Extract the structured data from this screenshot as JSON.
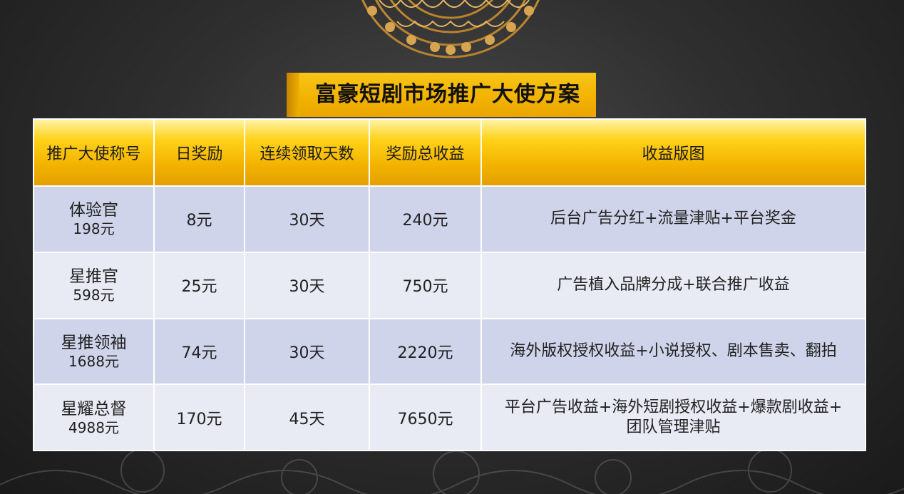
{
  "title": "富豪短剧市场推广大使方案",
  "table": {
    "headers": [
      "推广大使称号",
      "日奖励",
      "连续领取天数",
      "奖励总收益",
      "收益版图"
    ],
    "rows": [
      {
        "title": "体验官",
        "price": "198元",
        "daily": "8元",
        "days": "30天",
        "total": "240元",
        "benefits": "后台广告分红+流量津贴+平台奖金",
        "benefits2": ""
      },
      {
        "title": "星推官",
        "price": "598元",
        "daily": "25元",
        "days": "30天",
        "total": "750元",
        "benefits": "广告植入品牌分成+联合推广收益",
        "benefits2": ""
      },
      {
        "title": "星推领袖",
        "price": "1688元",
        "daily": "74元",
        "days": "30天",
        "total": "2220元",
        "benefits": "海外版权授权收益+小说授权、剧本售卖、翻拍",
        "benefits2": ""
      },
      {
        "title": "星耀总督",
        "price": "4988元",
        "daily": "170元",
        "days": "45天",
        "total": "7650元",
        "benefits": "平台广告收益+海外短剧授权收益+爆款剧收益+",
        "benefits2": "团队管理津贴"
      }
    ]
  },
  "colors": {
    "gold": "#f3b300",
    "row_blue": "#cfd4ea",
    "row_light": "#e8eaf4",
    "background": "#2f2f2f"
  },
  "icons": {
    "top": "gold-lace-ornament",
    "bottom": "damask-pattern"
  }
}
